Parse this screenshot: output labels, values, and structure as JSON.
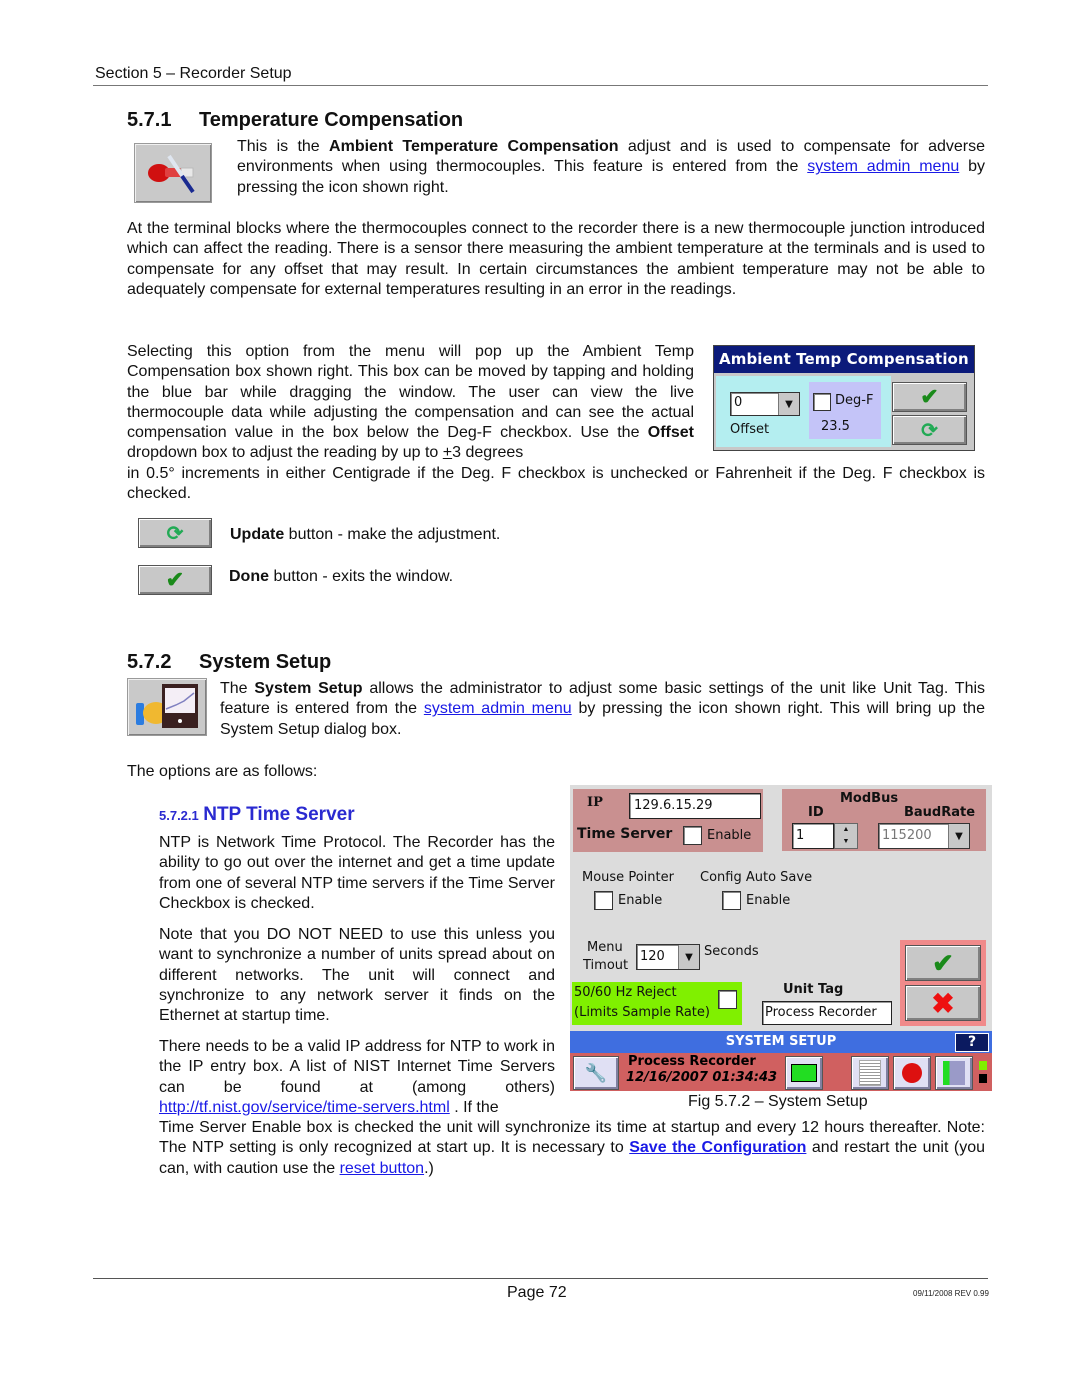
{
  "header": {
    "section": "Section 5 – Recorder Setup"
  },
  "s571": {
    "number": "5.7.1",
    "title": "Temperature Compensation",
    "intro": {
      "t1": "This is the ",
      "bold": "Ambient Temperature Compensation",
      "t2": " adjust and is used to compensate for adverse environments when using thermocouples. This feature is entered from the ",
      "link": "system admin menu",
      "t3": " by pressing the icon shown right."
    },
    "para1": "At the terminal blocks where the thermocouples connect to the recorder there is a new thermocouple junction introduced which can affect the reading. There is a sensor there measuring the ambient temperature at the terminals and is used to compensate for any offset that may result. In certain circumstances the ambient temperature may not be able to adequately compensate for external temperatures resulting in an error in the readings.",
    "para2": {
      "t1": " Selecting this option from the menu will pop up the Ambient Temp Compensation box shown right. This box can be moved by tapping and holding the blue bar while dragging the window. The user can view the live thermocouple data while adjusting the compensation and can see the actual compensation value in the box below the Deg-F checkbox. Use the ",
      "bold": "Offset",
      "t2": " dropdown box to adjust the reading by up to ",
      "pm": "+",
      "t3": "3 degrees",
      "cont": "in 0.5° increments in either Centigrade if the Deg. F checkbox is unchecked or Fahrenheit if the Deg. F checkbox is checked."
    },
    "update_item": {
      "bold": "Update",
      "text": " button - make the adjustment."
    },
    "done_item": {
      "bold": "Done",
      "text": " button - exits the window."
    }
  },
  "atc_dialog": {
    "title": "Ambient Temp Compensation",
    "offset_value": "0",
    "offset_label": "Offset",
    "degf_label": "Deg-F",
    "degf_checked": false,
    "comp_value": "23.5",
    "colors": {
      "title_bar": "#0b1a7a",
      "panel": "#b4eef0",
      "value_box": "#c4c4f8"
    }
  },
  "s572": {
    "number": "5.7.2",
    "title": "System Setup",
    "intro": {
      "t1": "The ",
      "bold": "System Setup",
      "t2": " allows the administrator to adjust some basic settings of the unit like Unit Tag. This feature is entered from the ",
      "link": "system admin menu",
      "t3": " by pressing the icon shown right. This will bring up the System Setup dialog box."
    },
    "options_intro": "The options are as follows:"
  },
  "s5721": {
    "number": "5.7.2.1",
    "title": "NTP Time Server",
    "para1": "NTP is Network Time Protocol. The Recorder has the ability to go out over the internet and get a time update from one of several NTP time servers if the Time Server Checkbox is checked.",
    "para2": "Note that you DO NOT NEED to use this unless you want to synchronize a number of units spread about on different networks. The unit will connect and synchronize to any network server it finds on the Ethernet at startup time.",
    "para3": {
      "t1": "There needs to be a valid IP address for NTP to work in the IP entry box. A list of NIST Internet Time Servers can be found at (among others) ",
      "link": "http://tf.nist.gov/service/time-servers.html",
      "t2": " .  If the",
      "cont": "Time Server Enable box is checked the unit will synchronize its time at startup and every 12 hours thereafter. Note: The NTP setting is only recognized at start up. It is necessary to ",
      "save_link": "Save the Configuration",
      "t3": " and restart the unit (you can, with caution use the ",
      "reset_link": "reset button",
      "t4": ".)"
    }
  },
  "system_setup_dialog": {
    "ip_label": "IP",
    "ip_value": "129.6.15.29",
    "time_server_label": "Time Server",
    "time_server_enable": "Enable",
    "modbus_label": "ModBus",
    "id_label": "ID",
    "id_value": "1",
    "baud_label": "BaudRate",
    "baud_value": "115200",
    "mouse_pointer_label": "Mouse Pointer",
    "mouse_pointer_enable": "Enable",
    "config_auto_save_label": "Config Auto Save",
    "config_auto_save_enable": "Enable",
    "menu_timeout_label1": "Menu",
    "menu_timeout_label2": "Timout",
    "menu_timeout_value": "120",
    "seconds_label": "Seconds",
    "hz_reject_line1": "50/60 Hz Reject",
    "hz_reject_line2": "(Limits Sample Rate)",
    "unit_tag_label": "Unit Tag",
    "unit_tag_value": "Process Recorder",
    "title_bar": "SYSTEM SETUP",
    "help": "?",
    "status_name": "Process Recorder",
    "status_datetime": "12/16/2007 01:34:43",
    "colors": {
      "rose": "#c99090",
      "green": "#80f000",
      "bar": "#3f6ee0",
      "status": "#d06060"
    }
  },
  "figure_caption": "Fig 5.7.2 – System Setup",
  "footer": {
    "page": "Page 72",
    "revision": "09/11/2008 REV 0.99"
  }
}
